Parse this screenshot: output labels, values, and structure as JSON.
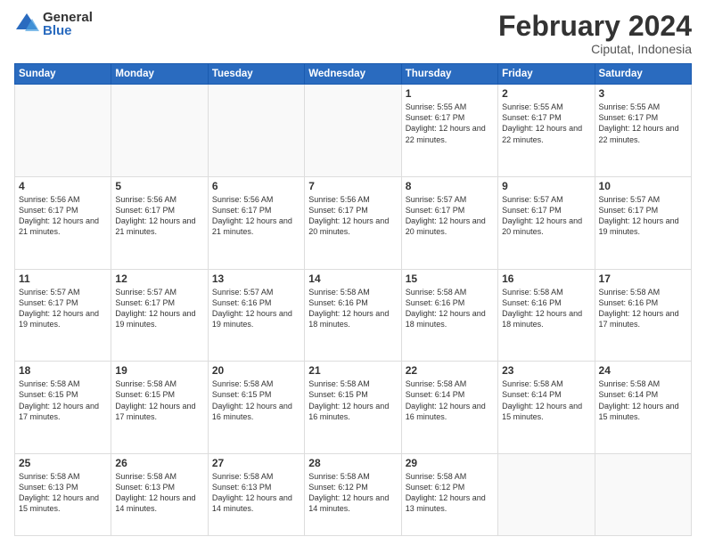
{
  "logo": {
    "general": "General",
    "blue": "Blue"
  },
  "header": {
    "month": "February 2024",
    "location": "Ciputat, Indonesia"
  },
  "days_of_week": [
    "Sunday",
    "Monday",
    "Tuesday",
    "Wednesday",
    "Thursday",
    "Friday",
    "Saturday"
  ],
  "weeks": [
    [
      {
        "day": null,
        "sunrise": null,
        "sunset": null,
        "daylight": null
      },
      {
        "day": null,
        "sunrise": null,
        "sunset": null,
        "daylight": null
      },
      {
        "day": null,
        "sunrise": null,
        "sunset": null,
        "daylight": null
      },
      {
        "day": null,
        "sunrise": null,
        "sunset": null,
        "daylight": null
      },
      {
        "day": "1",
        "sunrise": "Sunrise: 5:55 AM",
        "sunset": "Sunset: 6:17 PM",
        "daylight": "Daylight: 12 hours and 22 minutes."
      },
      {
        "day": "2",
        "sunrise": "Sunrise: 5:55 AM",
        "sunset": "Sunset: 6:17 PM",
        "daylight": "Daylight: 12 hours and 22 minutes."
      },
      {
        "day": "3",
        "sunrise": "Sunrise: 5:55 AM",
        "sunset": "Sunset: 6:17 PM",
        "daylight": "Daylight: 12 hours and 22 minutes."
      }
    ],
    [
      {
        "day": "4",
        "sunrise": "Sunrise: 5:56 AM",
        "sunset": "Sunset: 6:17 PM",
        "daylight": "Daylight: 12 hours and 21 minutes."
      },
      {
        "day": "5",
        "sunrise": "Sunrise: 5:56 AM",
        "sunset": "Sunset: 6:17 PM",
        "daylight": "Daylight: 12 hours and 21 minutes."
      },
      {
        "day": "6",
        "sunrise": "Sunrise: 5:56 AM",
        "sunset": "Sunset: 6:17 PM",
        "daylight": "Daylight: 12 hours and 21 minutes."
      },
      {
        "day": "7",
        "sunrise": "Sunrise: 5:56 AM",
        "sunset": "Sunset: 6:17 PM",
        "daylight": "Daylight: 12 hours and 20 minutes."
      },
      {
        "day": "8",
        "sunrise": "Sunrise: 5:57 AM",
        "sunset": "Sunset: 6:17 PM",
        "daylight": "Daylight: 12 hours and 20 minutes."
      },
      {
        "day": "9",
        "sunrise": "Sunrise: 5:57 AM",
        "sunset": "Sunset: 6:17 PM",
        "daylight": "Daylight: 12 hours and 20 minutes."
      },
      {
        "day": "10",
        "sunrise": "Sunrise: 5:57 AM",
        "sunset": "Sunset: 6:17 PM",
        "daylight": "Daylight: 12 hours and 19 minutes."
      }
    ],
    [
      {
        "day": "11",
        "sunrise": "Sunrise: 5:57 AM",
        "sunset": "Sunset: 6:17 PM",
        "daylight": "Daylight: 12 hours and 19 minutes."
      },
      {
        "day": "12",
        "sunrise": "Sunrise: 5:57 AM",
        "sunset": "Sunset: 6:17 PM",
        "daylight": "Daylight: 12 hours and 19 minutes."
      },
      {
        "day": "13",
        "sunrise": "Sunrise: 5:57 AM",
        "sunset": "Sunset: 6:16 PM",
        "daylight": "Daylight: 12 hours and 19 minutes."
      },
      {
        "day": "14",
        "sunrise": "Sunrise: 5:58 AM",
        "sunset": "Sunset: 6:16 PM",
        "daylight": "Daylight: 12 hours and 18 minutes."
      },
      {
        "day": "15",
        "sunrise": "Sunrise: 5:58 AM",
        "sunset": "Sunset: 6:16 PM",
        "daylight": "Daylight: 12 hours and 18 minutes."
      },
      {
        "day": "16",
        "sunrise": "Sunrise: 5:58 AM",
        "sunset": "Sunset: 6:16 PM",
        "daylight": "Daylight: 12 hours and 18 minutes."
      },
      {
        "day": "17",
        "sunrise": "Sunrise: 5:58 AM",
        "sunset": "Sunset: 6:16 PM",
        "daylight": "Daylight: 12 hours and 17 minutes."
      }
    ],
    [
      {
        "day": "18",
        "sunrise": "Sunrise: 5:58 AM",
        "sunset": "Sunset: 6:15 PM",
        "daylight": "Daylight: 12 hours and 17 minutes."
      },
      {
        "day": "19",
        "sunrise": "Sunrise: 5:58 AM",
        "sunset": "Sunset: 6:15 PM",
        "daylight": "Daylight: 12 hours and 17 minutes."
      },
      {
        "day": "20",
        "sunrise": "Sunrise: 5:58 AM",
        "sunset": "Sunset: 6:15 PM",
        "daylight": "Daylight: 12 hours and 16 minutes."
      },
      {
        "day": "21",
        "sunrise": "Sunrise: 5:58 AM",
        "sunset": "Sunset: 6:15 PM",
        "daylight": "Daylight: 12 hours and 16 minutes."
      },
      {
        "day": "22",
        "sunrise": "Sunrise: 5:58 AM",
        "sunset": "Sunset: 6:14 PM",
        "daylight": "Daylight: 12 hours and 16 minutes."
      },
      {
        "day": "23",
        "sunrise": "Sunrise: 5:58 AM",
        "sunset": "Sunset: 6:14 PM",
        "daylight": "Daylight: 12 hours and 15 minutes."
      },
      {
        "day": "24",
        "sunrise": "Sunrise: 5:58 AM",
        "sunset": "Sunset: 6:14 PM",
        "daylight": "Daylight: 12 hours and 15 minutes."
      }
    ],
    [
      {
        "day": "25",
        "sunrise": "Sunrise: 5:58 AM",
        "sunset": "Sunset: 6:13 PM",
        "daylight": "Daylight: 12 hours and 15 minutes."
      },
      {
        "day": "26",
        "sunrise": "Sunrise: 5:58 AM",
        "sunset": "Sunset: 6:13 PM",
        "daylight": "Daylight: 12 hours and 14 minutes."
      },
      {
        "day": "27",
        "sunrise": "Sunrise: 5:58 AM",
        "sunset": "Sunset: 6:13 PM",
        "daylight": "Daylight: 12 hours and 14 minutes."
      },
      {
        "day": "28",
        "sunrise": "Sunrise: 5:58 AM",
        "sunset": "Sunset: 6:12 PM",
        "daylight": "Daylight: 12 hours and 14 minutes."
      },
      {
        "day": "29",
        "sunrise": "Sunrise: 5:58 AM",
        "sunset": "Sunset: 6:12 PM",
        "daylight": "Daylight: 12 hours and 13 minutes."
      },
      {
        "day": null,
        "sunrise": null,
        "sunset": null,
        "daylight": null
      },
      {
        "day": null,
        "sunrise": null,
        "sunset": null,
        "daylight": null
      }
    ]
  ]
}
